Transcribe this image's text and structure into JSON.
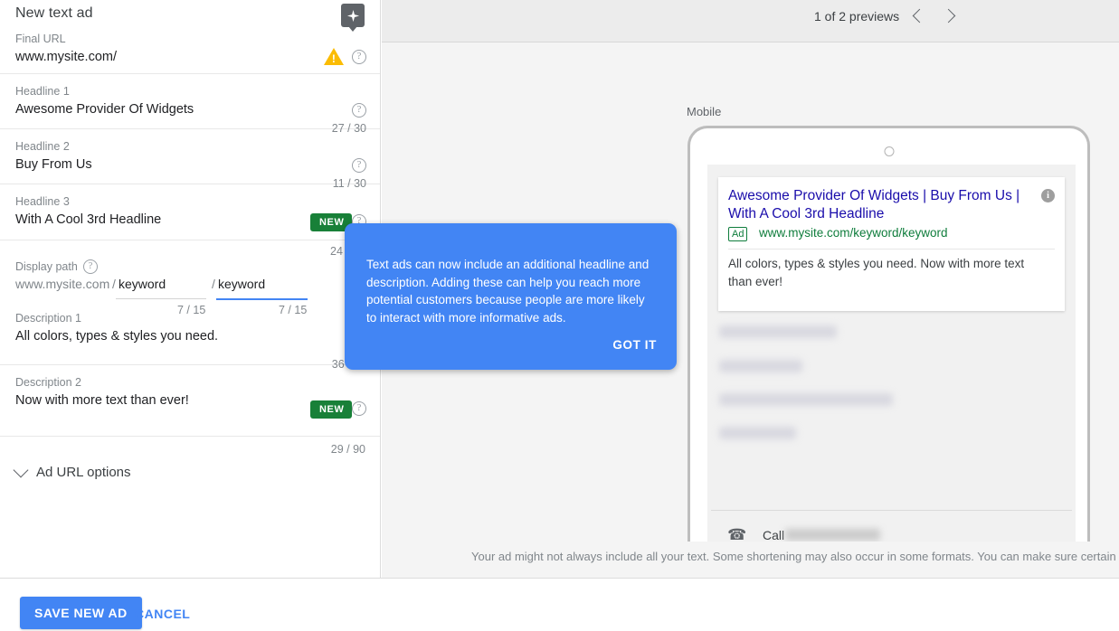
{
  "editor": {
    "title": "New text ad",
    "sparkle_icon": "sparkle-star-icon",
    "fields": [
      {
        "label": "Final URL",
        "value": "www.mysite.com/",
        "counter": "",
        "new": false,
        "warn": true
      },
      {
        "label": "Headline 1",
        "value": "Awesome Provider Of Widgets",
        "counter": "27 / 30",
        "new": false,
        "warn": false
      },
      {
        "label": "Headline 2",
        "value": "Buy From Us",
        "counter": "11 / 30",
        "new": false,
        "warn": false
      },
      {
        "label": "Headline 3",
        "value": "With A Cool 3rd Headline",
        "counter": "24",
        "new": true,
        "warn": false
      },
      {
        "label": "Description 1",
        "value": "All colors, types & styles you need.",
        "counter": "36 / 90",
        "new": false,
        "warn": false
      },
      {
        "label": "Description 2",
        "value": "Now with more text than ever!",
        "counter": "29 / 90",
        "new": true,
        "warn": false
      }
    ],
    "new_badge_label": "NEW",
    "help_glyph": "?",
    "warn_glyph": "!",
    "display_path": {
      "label": "Display path",
      "domain": "www.mysite.com",
      "slash": "/",
      "path1": "keyword",
      "path1_counter": "7 / 15",
      "path2": "keyword",
      "path2_counter": "7 / 15"
    },
    "ad_url_options": "Ad URL options"
  },
  "tooltip": {
    "text": "Text ads can now include an additional headline and description. Adding these can help you reach more potential customers because people are more likely to interact with more informative ads.",
    "button": "GOT IT"
  },
  "preview": {
    "count_label": "1 of 2 previews",
    "prev_icon": "chevron-left-icon",
    "next_icon": "chevron-right-icon",
    "device_label": "Mobile",
    "ad": {
      "title": "Awesome Provider Of Widgets | Buy From Us | With A Cool 3rd Headline",
      "badge": "Ad",
      "url": "www.mysite.com/keyword/keyword",
      "description": "All colors, types & styles you need. Now with more text than ever!",
      "info_glyph": "i"
    },
    "call_label": "Call",
    "call_icon": "phone-icon",
    "disclaimer": "Your ad might not always include all your text. Some shortening may also occur in some formats. You can make sure certain"
  },
  "footer": {
    "save_label": "SAVE NEW AD",
    "cancel_label": "CANCEL"
  },
  "colors": {
    "accent_blue": "#4285f4",
    "link_blue": "#1a0dab",
    "green": "#0f7d3c",
    "new_green": "#188038",
    "warn_amber": "#fbbc04"
  }
}
